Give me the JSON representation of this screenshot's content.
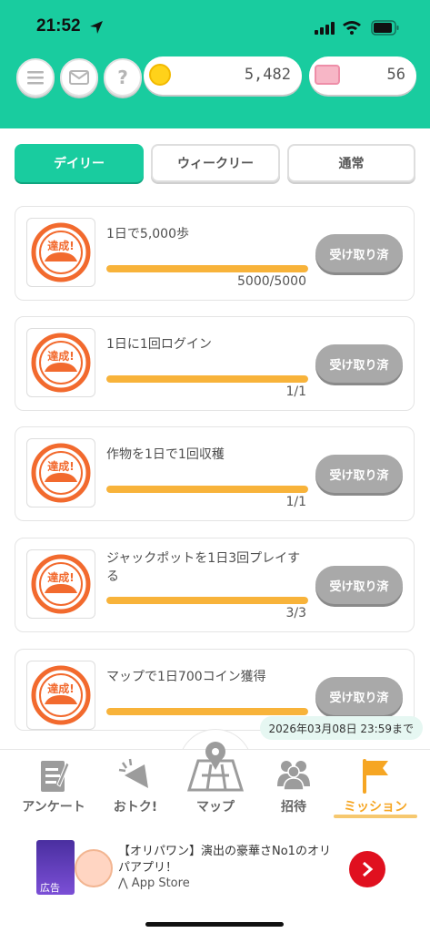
{
  "status_bar": {
    "time": "21:52"
  },
  "header": {
    "coins": "5,482",
    "tickets": "56",
    "help_label": "?"
  },
  "tabs": [
    {
      "label": "デイリー",
      "active": true
    },
    {
      "label": "ウィークリー",
      "active": false
    },
    {
      "label": "通常",
      "active": false
    }
  ],
  "badge_text": "達成!",
  "missions": [
    {
      "title": "1日で5,000歩",
      "progress_text": "5000/5000",
      "progress": 1.0,
      "button": "受け取り済"
    },
    {
      "title": "1日に1回ログイン",
      "progress_text": "1/1",
      "progress": 1.0,
      "button": "受け取り済"
    },
    {
      "title": "作物を1日で1回収穫",
      "progress_text": "1/1",
      "progress": 1.0,
      "button": "受け取り済"
    },
    {
      "title": "ジャックポットを1日3回プレイする",
      "progress_text": "3/3",
      "progress": 1.0,
      "button": "受け取り済"
    },
    {
      "title": "マップで1日700コイン獲得",
      "progress_text": "",
      "progress": 1.0,
      "button": "受け取り済"
    }
  ],
  "deadline": "2026年03月08日 23:59まで",
  "nav": [
    {
      "label": "アンケート",
      "icon": "clipboard-icon"
    },
    {
      "label": "おトク!",
      "icon": "megaphone-icon"
    },
    {
      "label": "マップ",
      "icon": "map-icon"
    },
    {
      "label": "招待",
      "icon": "people-icon"
    },
    {
      "label": "ミッション",
      "icon": "flag-icon",
      "active": true
    }
  ],
  "ad": {
    "tag": "広告",
    "text": "【オリパワン】演出の豪華さNo1のオリパアプリ！",
    "store": "App Store"
  },
  "colors": {
    "accent": "#19cc9f",
    "progress": "#f8b33a",
    "active_nav": "#f6a623"
  }
}
